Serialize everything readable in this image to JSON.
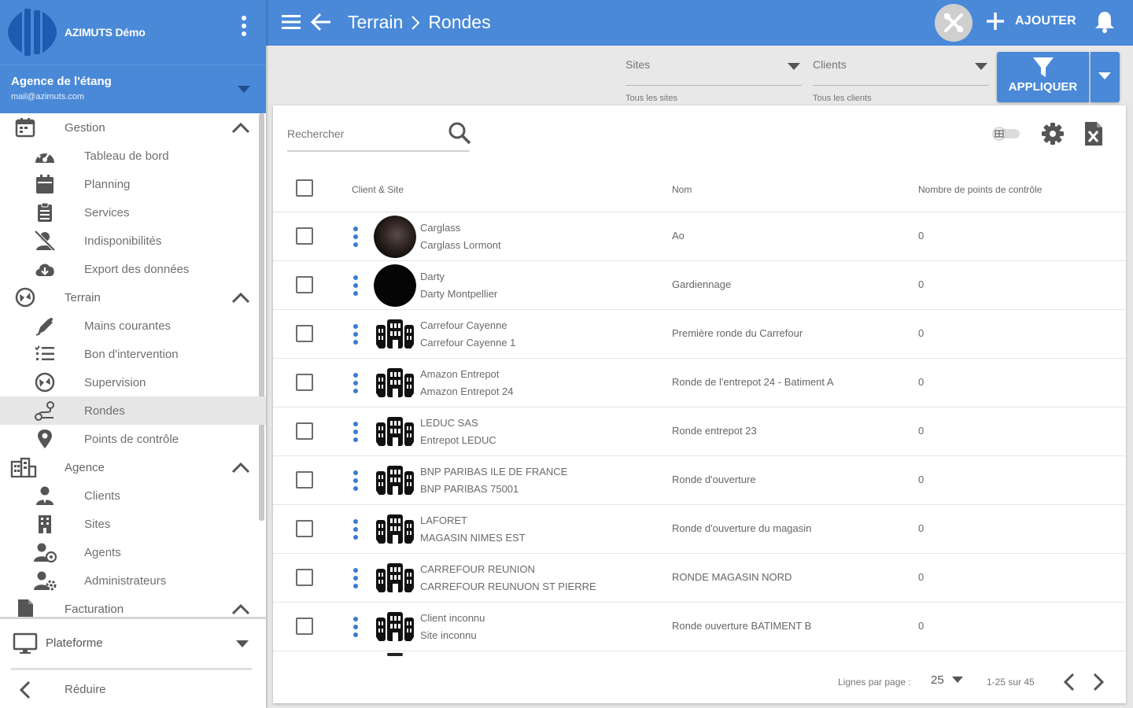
{
  "app": {
    "brand_name": "AZIMUTS Démo",
    "agency_name": "Agence de l'étang",
    "agency_email": "mail@azimuts.com"
  },
  "sidebar": {
    "sections": [
      {
        "label": "Gestion",
        "icon": "calendar-icon",
        "items": [
          {
            "label": "Tableau de bord",
            "icon": "dashboard-icon"
          },
          {
            "label": "Planning",
            "icon": "planning-icon"
          },
          {
            "label": "Services",
            "icon": "clipboard-icon"
          },
          {
            "label": "Indisponibilités",
            "icon": "user-off-icon"
          },
          {
            "label": "Export des données",
            "icon": "cloud-download-icon"
          }
        ]
      },
      {
        "label": "Terrain",
        "icon": "compass-icon",
        "items": [
          {
            "label": "Mains courantes",
            "icon": "pen-icon"
          },
          {
            "label": "Bon d'intervention",
            "icon": "list-icon"
          },
          {
            "label": "Supervision",
            "icon": "compass-icon"
          },
          {
            "label": "Rondes",
            "icon": "route-icon",
            "active": true
          },
          {
            "label": "Points de contrôle",
            "icon": "map-pin-icon"
          }
        ]
      },
      {
        "label": "Agence",
        "icon": "building-icon",
        "items": [
          {
            "label": "Clients",
            "icon": "client-icon"
          },
          {
            "label": "Sites",
            "icon": "site-icon"
          },
          {
            "label": "Agents",
            "icon": "agent-icon"
          },
          {
            "label": "Administrateurs",
            "icon": "admin-icon"
          }
        ]
      },
      {
        "label": "Facturation",
        "icon": "invoice-icon",
        "items": []
      }
    ],
    "platform_label": "Plateforme",
    "collapse_label": "Réduire"
  },
  "header": {
    "breadcrumb": [
      "Terrain",
      "Rondes"
    ],
    "add_label": "AJOUTER"
  },
  "filters": {
    "sites": {
      "label": "Sites",
      "value": "Tous les sites"
    },
    "clients": {
      "label": "Clients",
      "value": "Tous les clients"
    },
    "apply_label": "APPLIQUER"
  },
  "table": {
    "search_placeholder": "Rechercher",
    "columns": [
      "Client & Site",
      "Nom",
      "Nombre de points de contrôle"
    ],
    "rows": [
      {
        "client": "Carglass",
        "site": "Carglass Lormont",
        "name": "Ao",
        "count": "0",
        "avatar": "photo-dark"
      },
      {
        "client": "Darty",
        "site": "Darty Montpellier",
        "name": "Gardiennage",
        "count": "0",
        "avatar": "photo-black"
      },
      {
        "client": "Carrefour Cayenne",
        "site": "Carrefour Cayenne 1",
        "name": "Première ronde du Carrefour",
        "count": "0",
        "avatar": "building"
      },
      {
        "client": "Amazon Entrepot",
        "site": "Amazon Entrepot 24",
        "name": "Ronde de l'entrepot 24 - Batiment A",
        "count": "0",
        "avatar": "building"
      },
      {
        "client": "LEDUC SAS",
        "site": "Entrepot LEDUC",
        "name": "Ronde entrepot 23",
        "count": "0",
        "avatar": "building"
      },
      {
        "client": "BNP PARIBAS ILE DE FRANCE",
        "site": "BNP PARIBAS 75001",
        "name": "Ronde d'ouverture",
        "count": "0",
        "avatar": "building"
      },
      {
        "client": "LAFORET",
        "site": "MAGASIN NIMES EST",
        "name": "Ronde d'ouverture du magasin",
        "count": "0",
        "avatar": "building"
      },
      {
        "client": "CARREFOUR REUNION",
        "site": "CARREFOUR REUNUON ST PIERRE",
        "name": "RONDE MAGASIN NORD",
        "count": "0",
        "avatar": "building"
      },
      {
        "client": "Client inconnu",
        "site": "Site inconnu",
        "name": "Ronde ouverture BATIMENT B",
        "count": "0",
        "avatar": "building"
      }
    ]
  },
  "pagination": {
    "rows_per_page_label": "Lignes par page :",
    "rows_per_page": "25",
    "range": "1-25 sur 45"
  },
  "colors": {
    "primary": "#4a89d8",
    "kebab": "#3a7bd5",
    "active_item": "#e6e6e6"
  }
}
